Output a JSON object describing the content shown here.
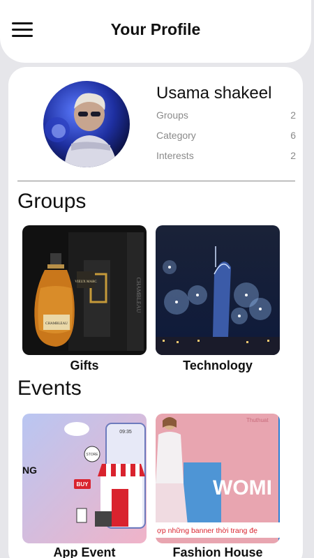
{
  "header": {
    "title": "Your Profile"
  },
  "profile": {
    "name": "Usama shakeel",
    "stats": [
      {
        "label": "Groups",
        "value": "2"
      },
      {
        "label": "Category",
        "value": "6"
      },
      {
        "label": "Interests",
        "value": "2"
      }
    ]
  },
  "groups": {
    "title": "Groups",
    "items": [
      {
        "label": "Gifts",
        "image_text": [
          "VIEUX MARC",
          "CHAMBLEAU"
        ]
      },
      {
        "label": "Technology"
      }
    ]
  },
  "events": {
    "title": "Events",
    "items": [
      {
        "label": "App Event",
        "image_text": [
          "09:35",
          "STORE",
          "BUY",
          "NG"
        ]
      },
      {
        "label": "Fashion House",
        "image_text": [
          "WOMI",
          "ợp những banner thời trang đẹ",
          "Thuthuat"
        ]
      }
    ]
  },
  "colors": {
    "background": "#e6e6ea",
    "card": "#ffffff",
    "text": "#111111",
    "muted": "#8a8a8a"
  }
}
